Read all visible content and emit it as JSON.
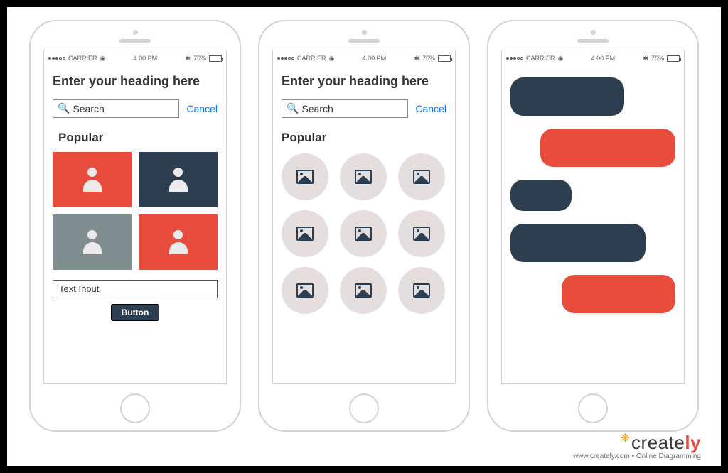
{
  "status": {
    "carrier": "CARRIER",
    "time": "4.00 PM",
    "battery_pct": "75%"
  },
  "phone1": {
    "heading": "Enter your heading here",
    "search_placeholder": "Search",
    "cancel": "Cancel",
    "section": "Popular",
    "tiles": [
      {
        "color": "orange",
        "icon": "person-icon"
      },
      {
        "color": "navy",
        "icon": "person-icon"
      },
      {
        "color": "grey",
        "icon": "person-icon"
      },
      {
        "color": "orange",
        "icon": "person-icon"
      }
    ],
    "text_input_placeholder": "Text Input",
    "button_label": "Button"
  },
  "phone2": {
    "heading": "Enter your heading here",
    "search_placeholder": "Search",
    "cancel": "Cancel",
    "section": "Popular",
    "circles": [
      {
        "icon": "image-icon"
      },
      {
        "icon": "image-icon"
      },
      {
        "icon": "image-icon"
      },
      {
        "icon": "image-icon"
      },
      {
        "icon": "image-icon"
      },
      {
        "icon": "image-icon"
      },
      {
        "icon": "image-icon"
      },
      {
        "icon": "image-icon"
      },
      {
        "icon": "image-icon"
      }
    ]
  },
  "phone3": {
    "bubbles": [
      {
        "side": "left",
        "size": "b1"
      },
      {
        "side": "right",
        "size": "b2"
      },
      {
        "side": "left",
        "size": "b3"
      },
      {
        "side": "left",
        "size": "b4"
      },
      {
        "side": "right",
        "size": "b5"
      }
    ]
  },
  "brand": {
    "name_a": "create",
    "name_b": "ly",
    "tagline": "www.creately.com • Online Diagramming"
  },
  "colors": {
    "navy": "#2c3e50",
    "orange": "#e84c3d",
    "grey_tile": "#808e8f",
    "circle_fill": "#e5dedf",
    "action_blue": "#007aff"
  }
}
